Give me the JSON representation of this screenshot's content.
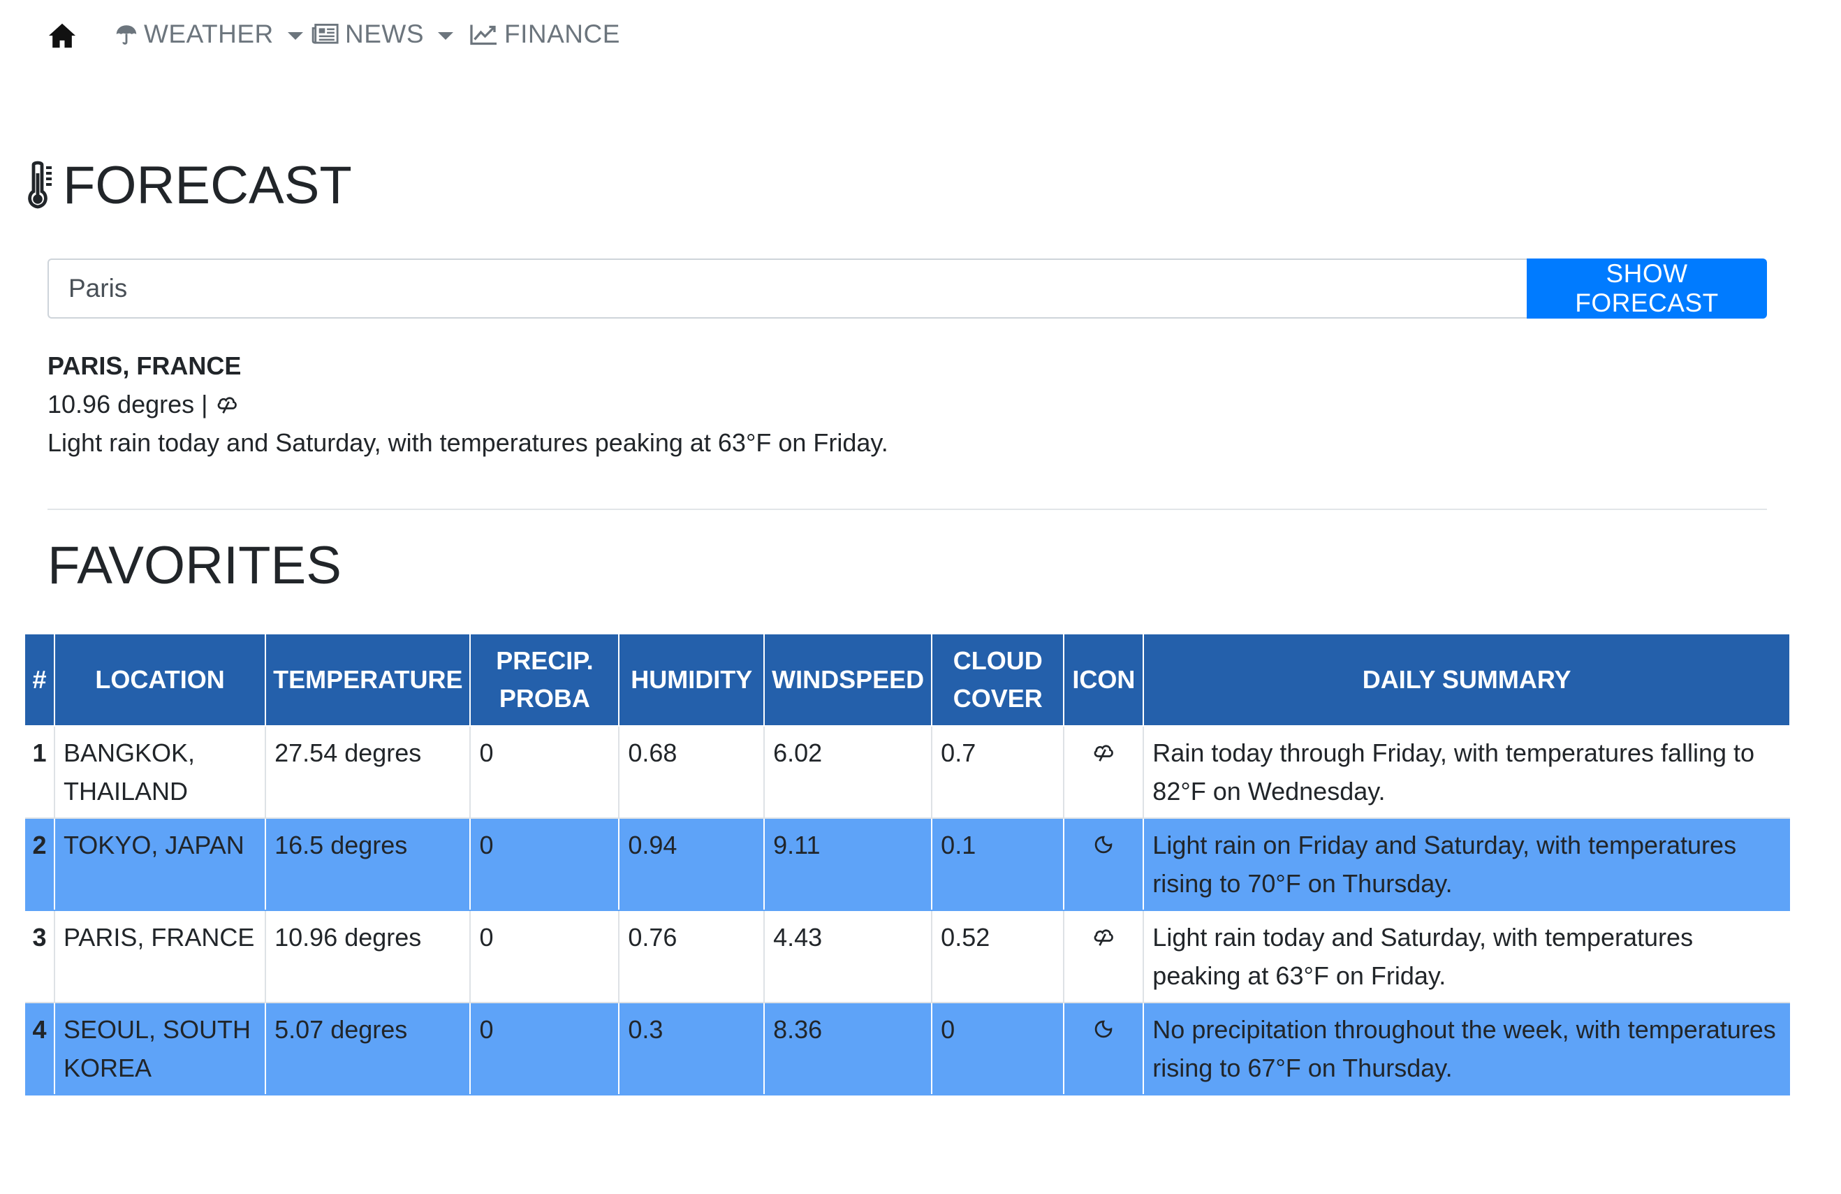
{
  "nav": {
    "home_icon": "home-icon",
    "items": [
      {
        "label": "WEATHER",
        "icon": "umbrella-icon",
        "dropdown": true
      },
      {
        "label": "NEWS",
        "icon": "newspaper-icon",
        "dropdown": true
      },
      {
        "label": "FINANCE",
        "icon": "line-chart-icon",
        "dropdown": false
      }
    ]
  },
  "forecast": {
    "heading": "FORECAST",
    "heading_icon": "thermometer-icon",
    "search_value": "Paris",
    "button_label": "SHOW FORECAST",
    "current": {
      "location": "PARIS, FRANCE",
      "temperature_text": "10.96 degres |",
      "icon": "rain-cloud-icon",
      "summary": "Light rain today and Saturday, with temperatures peaking at 63°F on Friday."
    }
  },
  "favorites": {
    "heading": "FAVORITES",
    "columns": [
      "#",
      "LOCATION",
      "TEMPERATURE",
      "PRECIP. PROBA",
      "HUMIDITY",
      "WINDSPEED",
      "CLOUD COVER",
      "ICON",
      "DAILY SUMMARY"
    ],
    "rows": [
      {
        "num": "1",
        "location": "BANGKOK, THAILAND",
        "temperature": "27.54 degres",
        "precip": "0",
        "humidity": "0.68",
        "windspeed": "6.02",
        "cloud": "0.7",
        "icon": "rain-cloud-icon",
        "summary": "Rain today through Friday, with temperatures falling to 82°F on Wednesday."
      },
      {
        "num": "2",
        "location": "TOKYO, JAPAN",
        "temperature": "16.5 degres",
        "precip": "0",
        "humidity": "0.94",
        "windspeed": "9.11",
        "cloud": "0.1",
        "icon": "clear-night-icon",
        "summary": "Light rain on Friday and Saturday, with temperatures rising to 70°F on Thursday."
      },
      {
        "num": "3",
        "location": "PARIS, FRANCE",
        "temperature": "10.96 degres",
        "precip": "0",
        "humidity": "0.76",
        "windspeed": "4.43",
        "cloud": "0.52",
        "icon": "rain-cloud-icon",
        "summary": "Light rain today and Saturday, with temperatures peaking at 63°F on Friday."
      },
      {
        "num": "4",
        "location": "SEOUL, SOUTH KOREA",
        "temperature": "5.07 degres",
        "precip": "0",
        "humidity": "0.3",
        "windspeed": "8.36",
        "cloud": "0",
        "icon": "clear-night-icon",
        "summary": "No precipitation throughout the week, with temperatures rising to 67°F on Thursday."
      }
    ]
  },
  "colors": {
    "primary_button": "#007bff",
    "table_header": "#2460ab",
    "row_highlight": "#5ea3f8"
  }
}
